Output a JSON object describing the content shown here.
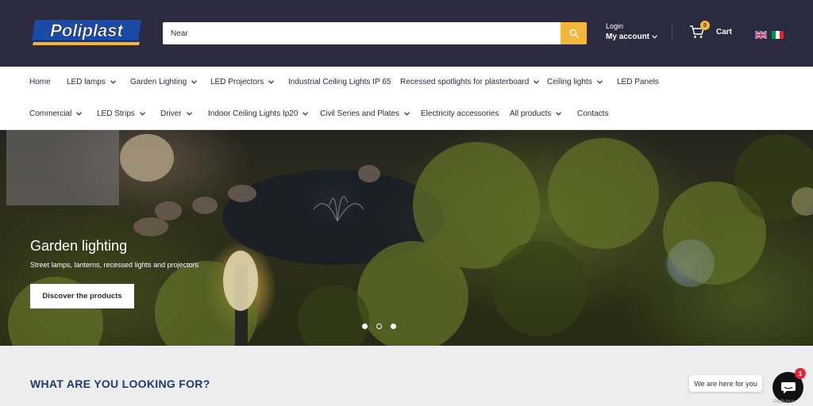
{
  "brand": {
    "logo_text": "Poliplast",
    "colors": {
      "header_bg": "#2b2a3e",
      "accent": "#f2b63b",
      "heading_blue": "#1e3a6e"
    }
  },
  "header": {
    "search": {
      "value": "Near",
      "button_icon": "search-icon"
    },
    "account": {
      "login": "Login",
      "my_account": "My account"
    },
    "cart": {
      "label": "Cart",
      "count": "0"
    },
    "languages": [
      "English",
      "Italiano"
    ]
  },
  "nav": {
    "row1": [
      {
        "label": "Home",
        "has_dropdown": false
      },
      {
        "label": "LED lamps",
        "has_dropdown": true
      },
      {
        "label": "Garden Lighting",
        "has_dropdown": true
      },
      {
        "label": "LED Projectors",
        "has_dropdown": true
      },
      {
        "label": "Industrial Ceiling Lights IP 65",
        "has_dropdown": false
      },
      {
        "label": "Recessed spotlights for plasterboard",
        "has_dropdown": true
      },
      {
        "label": "Ceiling lights",
        "has_dropdown": true
      },
      {
        "label": "LED Panels",
        "has_dropdown": false
      }
    ],
    "row2": [
      {
        "label": "Commercial",
        "has_dropdown": true
      },
      {
        "label": "LED Strips",
        "has_dropdown": true
      },
      {
        "label": "Driver",
        "has_dropdown": true
      },
      {
        "label": "Indoor Ceiling Lights Ip20",
        "has_dropdown": true
      },
      {
        "label": "Civil Series and Plates",
        "has_dropdown": true
      },
      {
        "label": "Electricity accessories",
        "has_dropdown": false
      },
      {
        "label": "All products",
        "has_dropdown": true
      },
      {
        "label": "Contacts",
        "has_dropdown": false
      }
    ]
  },
  "hero": {
    "title": "Garden lighting",
    "subtitle": "Street lamps, lanterns, recessed lights and projectors",
    "cta": "Discover the products",
    "slides": 3,
    "active_slide": 2
  },
  "main": {
    "section_title": "WHAT ARE YOU LOOKING FOR?"
  },
  "chat": {
    "bubble_text": "We are here for you",
    "badge": "1",
    "credit": "GetButton"
  }
}
